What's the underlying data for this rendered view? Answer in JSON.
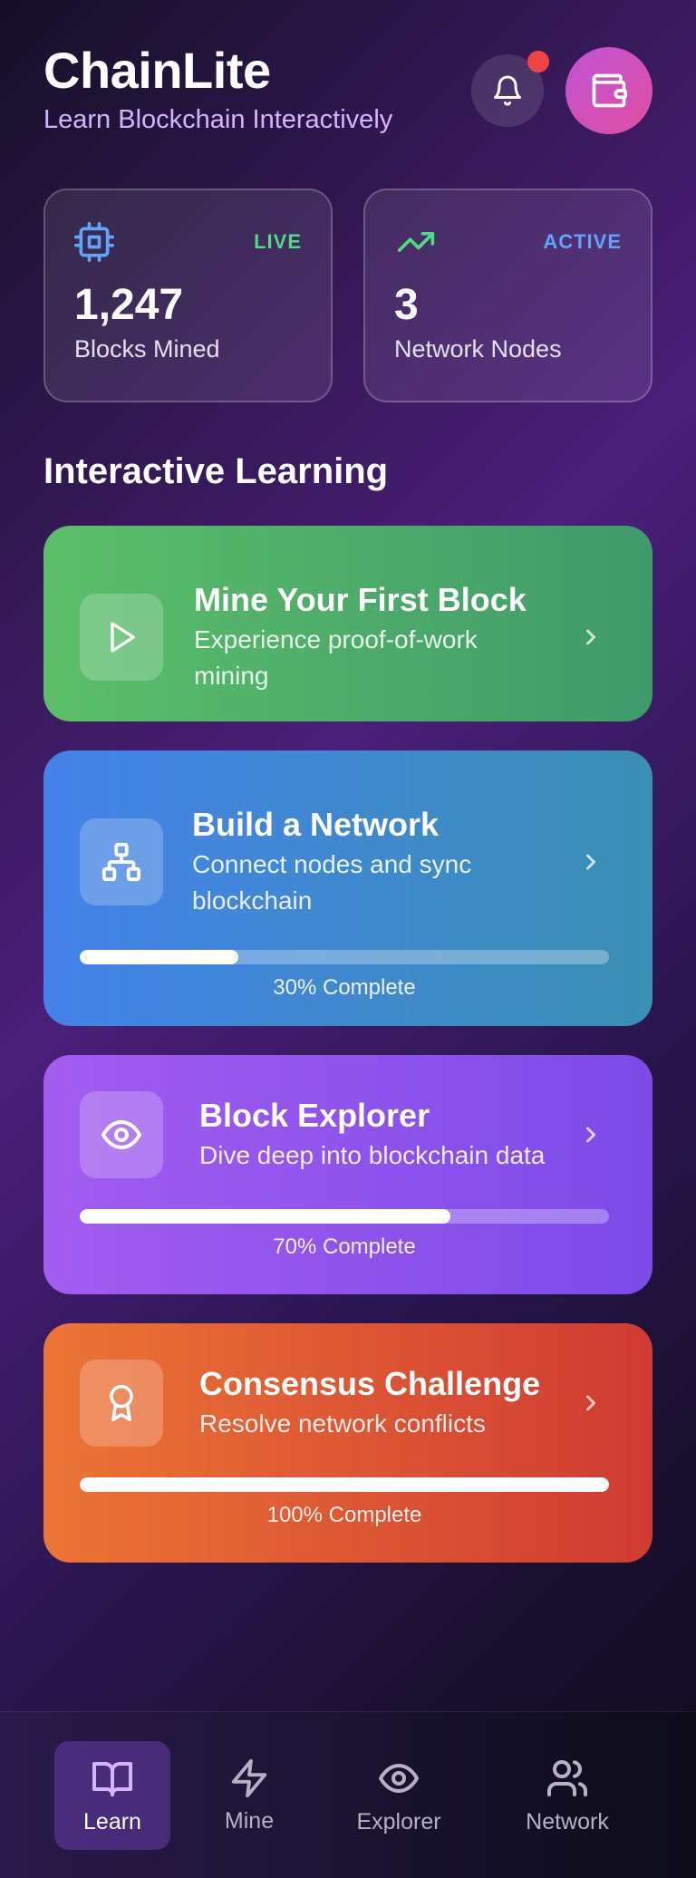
{
  "header": {
    "title": "ChainLite",
    "subtitle": "Learn Blockchain Interactively",
    "icons": [
      "bell-icon",
      "wallet-icon"
    ]
  },
  "stats": [
    {
      "badge": "LIVE",
      "badge_color": "#4ade80",
      "value": "1,247",
      "label": "Blocks Mined",
      "icon": "cpu-icon"
    },
    {
      "badge": "ACTIVE",
      "badge_color": "#60a5fa",
      "value": "3",
      "label": "Network Nodes",
      "icon": "trending-up-icon"
    }
  ],
  "section": {
    "title": "Interactive Learning"
  },
  "cards": [
    {
      "title": "Mine Your First Block",
      "desc_line1": "Experience proof-of-work",
      "desc_line2": "mining",
      "icon": "play-icon"
    },
    {
      "title": "Build a Network",
      "desc_line1": "Connect nodes and sync",
      "desc_line2": "blockchain",
      "icon": "network-icon",
      "progress": 0.3,
      "progress_label": "30% Complete"
    },
    {
      "title": "Block Explorer",
      "desc_line1": "Dive deep into blockchain data",
      "icon": "eye-icon",
      "progress": 0.7,
      "progress_label": "70% Complete"
    },
    {
      "title": "Consensus Challenge",
      "desc_line1": "Resolve network conflicts",
      "icon": "award-icon",
      "progress": 1.0,
      "progress_label": "100% Complete"
    }
  ],
  "nav": [
    {
      "label": "Learn",
      "icon": "book-icon",
      "active": true
    },
    {
      "label": "Mine",
      "icon": "zap-icon"
    },
    {
      "label": "Explorer",
      "icon": "eye-icon"
    },
    {
      "label": "Network",
      "icon": "users-icon"
    }
  ]
}
